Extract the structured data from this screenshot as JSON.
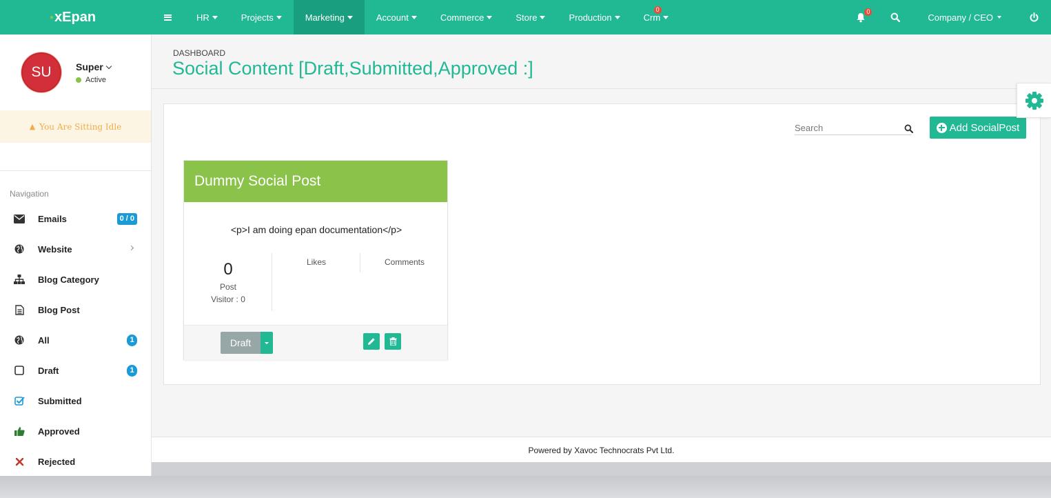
{
  "brand": {
    "name": "xEpan"
  },
  "topnav": {
    "items": [
      {
        "label": "HR"
      },
      {
        "label": "Projects"
      },
      {
        "label": "Marketing"
      },
      {
        "label": "Account"
      },
      {
        "label": "Commerce"
      },
      {
        "label": "Store"
      },
      {
        "label": "Production"
      },
      {
        "label": "Crm",
        "badge": "0"
      }
    ],
    "notification_badge": "0",
    "user_menu": "Company / CEO"
  },
  "profile": {
    "initials": "SU",
    "name": "Super",
    "status": "Active",
    "idle_message": "You Are Sitting Idle"
  },
  "sidebar": {
    "title": "Navigation",
    "items": [
      {
        "label": "Emails",
        "icon": "envelope-icon",
        "badge": "0 / 0"
      },
      {
        "label": "Website",
        "icon": "globe-icon"
      },
      {
        "label": "Blog Category",
        "icon": "sitemap-icon"
      },
      {
        "label": "Blog Post",
        "icon": "file-text-icon"
      },
      {
        "label": "All",
        "icon": "globe-icon",
        "badge": "1"
      },
      {
        "label": "Draft",
        "icon": "square-o-icon",
        "badge": "1"
      },
      {
        "label": "Submitted",
        "icon": "check-square-icon"
      },
      {
        "label": "Approved",
        "icon": "thumbs-up-icon"
      },
      {
        "label": "Rejected",
        "icon": "times-icon"
      }
    ]
  },
  "page": {
    "breadcrumb": "DASHBOARD",
    "title": "Social Content [Draft,Submitted,Approved :]"
  },
  "toolbar": {
    "search_placeholder": "Search",
    "add_label": "Add SocialPost"
  },
  "card": {
    "title": "Dummy Social Post",
    "body": "<p>I am doing epan documentation</p>",
    "post_count": "0",
    "post_label": "Post",
    "visitor_text": "Visitor : 0",
    "likes_label": "Likes",
    "comments_label": "Comments",
    "status_label": "Draft"
  },
  "footer": {
    "text": "Powered by Xavoc Technocrats Pvt Ltd."
  },
  "colors": {
    "primary": "#21b894",
    "card_header": "#8bc34a",
    "avatar": "#d32f3a",
    "badge_blue": "#1a9ad6",
    "badge_red": "#e74c3c",
    "idle_bg": "#fdf5e4",
    "idle_text": "#f0ad4e"
  }
}
